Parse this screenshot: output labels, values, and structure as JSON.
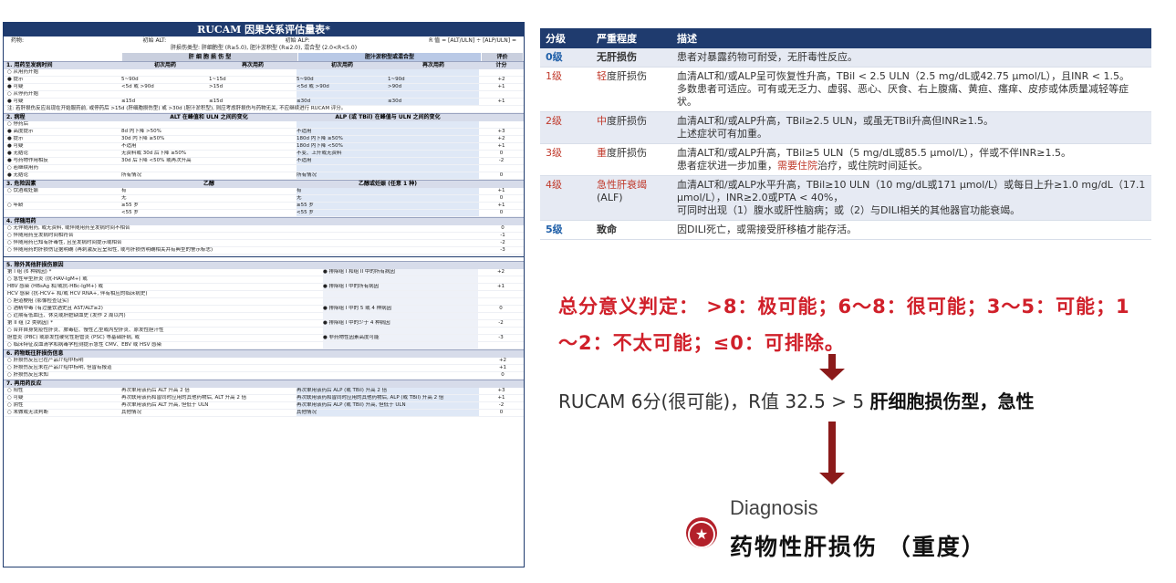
{
  "rucam": {
    "title": "RUCAM 因果关系评估量表*",
    "meta_line1": [
      "药物:",
      "初始 ALT:",
      "初始 ALP:",
      "R 值 = [ALT/ULN] ÷ [ALP/ULN] ="
    ],
    "meta_line2": "肝损伤类型: 肝细胞型 (R≥5.0), 胆汁淤积型 (R≤2.0), 混合型 (2.0<R<5.0)",
    "col_left": "肝 细 胞 损 伤 型",
    "col_right": "胆汁淤积型或混合型",
    "col_score": "评价",
    "sec1": {
      "name": "1. 用药至发病时间",
      "a1": "初次用药",
      "a2": "再次用药",
      "b1": "初次用药",
      "b2": "再次用药",
      "c": "计分"
    },
    "sec1_rows": [
      {
        "c0": "○ 从用药开始",
        "c1": "",
        "c2": "",
        "c3": "",
        "c4": "",
        "c5": ""
      },
      {
        "c0": "● 提示",
        "c1": "5~90d",
        "c2": "1~15d",
        "c3": "5~90d",
        "c4": "1~90d",
        "c5": "+2"
      },
      {
        "c0": "● 可疑",
        "c1": "<5d 或 >90d",
        "c2": ">15d",
        "c3": "<5d 或 >90d",
        "c4": ">90d",
        "c5": "+1"
      },
      {
        "c0": "○ 从停药开始",
        "c1": "",
        "c2": "",
        "c3": "",
        "c4": "",
        "c5": ""
      },
      {
        "c0": "● 可疑",
        "c1": "≤15d",
        "c2": "≤15d",
        "c3": "≤30d",
        "c4": "≤30d",
        "c5": "+1"
      }
    ],
    "sec1_note": "注: 若肝损伤反应出现在开始服药前, 或停药后 >15d (肝细胞损伤型) 或 >30d (胆汁淤积型), 则应考虑肝损伤与药物无关, 不应继续进行 RUCAM 评分。",
    "sec2": {
      "name": "2. 病程",
      "a": "ALT 在峰值和 ULN 之间的变化",
      "b": "ALP (或 TBil) 在峰值与 ULN 之间的变化"
    },
    "sec2_rows": [
      {
        "c0": "○ 停药后",
        "a": "",
        "b": "",
        "s": ""
      },
      {
        "c0": "● 高度提示",
        "a": "8d 内下降 >50%",
        "b": "不适用",
        "s": "+3"
      },
      {
        "c0": "● 提示",
        "a": "30d 内下降 ≥50%",
        "b": "180d 内下降 ≥50%",
        "s": "+2"
      },
      {
        "c0": "● 可疑",
        "a": "不适用",
        "b": "180d 内下降 <50%",
        "s": "+1"
      },
      {
        "c0": "● 无结论",
        "a": "无资料或 30d 后下降 ≥50%",
        "b": "不变、上升或无资料",
        "s": "0"
      },
      {
        "c0": "● 与药物作用相反",
        "a": "30d 后下降 <50% 或再次升高",
        "b": "不适用",
        "s": "-2"
      },
      {
        "c0": "○ 若继续用药",
        "a": "",
        "b": "",
        "s": ""
      },
      {
        "c0": "● 无结论",
        "a": "所有情况",
        "b": "所有情况",
        "s": "0"
      }
    ],
    "sec3": {
      "name": "3. 危险因素",
      "a": "乙醇",
      "b": "乙醇或妊娠 (任意 1 种)"
    },
    "sec3_rows": [
      {
        "c0": "○ 饮酒或妊娠",
        "a": "有",
        "b": "有",
        "s": "+1"
      },
      {
        "c0": "",
        "a": "无",
        "b": "无",
        "s": "0"
      },
      {
        "c0": "○ 年龄",
        "a": "≥55 岁",
        "b": "≥55 岁",
        "s": "+1"
      },
      {
        "c0": "",
        "a": "<55 岁",
        "b": "<55 岁",
        "s": "0"
      }
    ],
    "sec4": {
      "name": "4. 伴随用药"
    },
    "sec4_rows": [
      {
        "t": "○ 无伴随用药, 或无资料, 或伴随用药至发病时间不相合",
        "s": "0"
      },
      {
        "t": "○ 伴随用药至发病时间相符合",
        "s": "-1"
      },
      {
        "t": "○ 伴随用药已知有肝毒性, 且至发病时间提示或相合",
        "s": "-2"
      },
      {
        "t": "○ 伴随用药的肝损伤证据明确 (再刺激反应呈阳性, 或与肝损伤明确相关并有典型的警示标志)",
        "s": "-3"
      }
    ],
    "sec5": {
      "name": "5. 除外其他肝损伤原因"
    },
    "sec5_rows": [
      {
        "l": "第 I 组 (6 种病因) *",
        "m": "● 排除组 I 和组 II 中的所有病因",
        "s": "+2"
      },
      {
        "l": "○ 急性甲型肝炎 (抗-HAV-IgM+) 或",
        "m": "",
        "s": ""
      },
      {
        "l": "HBV 感染 (HBsAg 和/或抗-HBc-IgM+) 或",
        "m": "● 排除组 I 中的所有病因",
        "s": "+1"
      },
      {
        "l": "HCV 感染 (抗-HCV+ 和/或 HCV RNA+, 伴有相应的临床病史)",
        "m": "",
        "s": ""
      },
      {
        "l": "○ 胆道梗阻 (影像检查证实)",
        "m": "",
        "s": ""
      },
      {
        "l": "○ 酒精中毒 (有过量饮酒史且 AST/ALT≥2)",
        "m": "● 排除组 I 中的 5 或 4 种病因",
        "s": "0"
      },
      {
        "l": "○ 近期有低血压、休克或肝脏缺血史 (发作 2 周以内)",
        "m": "",
        "s": ""
      },
      {
        "l": "第 II 组 (2 类病因) *",
        "m": "● 排除组 I 中的少于 4 种病因",
        "s": "-2"
      },
      {
        "l": "○ 合并自身免疫性肝炎、脓毒症、慢性乙型或丙型肝炎、原发性胆汁性",
        "m": "",
        "s": ""
      },
      {
        "l": "胆管炎 (PBC) 或原发性硬化性胆管炎 (PSC) 等基础肝病, 或",
        "m": "● 非药物性因素高度可能",
        "s": "-3"
      },
      {
        "l": "○ 临床特征及血清学和病毒学检测提示急性 CMV、EBV 或 HSV 感染",
        "m": "",
        "s": ""
      }
    ],
    "sec6": {
      "name": "6. 药物既往肝损伤信息"
    },
    "sec6_rows": [
      {
        "t": "○ 肝损伤反应已在产品介绍中标明",
        "s": "+2"
      },
      {
        "t": "○ 肝损伤反应未在产品介绍中标明, 但曾有报道",
        "s": "+1"
      },
      {
        "t": "○ 肝损伤反应未知",
        "s": "0"
      }
    ],
    "sec7": {
      "name": "7. 再用药反应"
    },
    "sec7_rows": [
      {
        "c0": "○ 阳性",
        "a": "再次单用该药后 ALT 升高 2 倍",
        "b": "再次单用该药后 ALP (或 TBil) 升高 2 倍",
        "s": "+3"
      },
      {
        "c0": "○ 可疑",
        "a": "再次联用该药和曾同时应用的其他药物后, ALT 升高 2 倍",
        "b": "再次联用该药和曾同时应用的其他药物后, ALP (或 TBil) 升高 2 倍",
        "s": "+1"
      },
      {
        "c0": "○ 阴性",
        "a": "再次单用该药后 ALT 升高, 但低于 ULN",
        "b": "再次单用该药后 ALP (或 TBil) 升高, 但低于 ULN",
        "s": "-2"
      },
      {
        "c0": "○ 未做或无法判断",
        "a": "其他情况",
        "b": "其他情况",
        "s": "0"
      }
    ]
  },
  "grade_table": {
    "headers": [
      "分级",
      "严重程度",
      "描述"
    ],
    "rows": [
      {
        "level": "0级",
        "severity": "无肝损伤",
        "desc": [
          "患者对暴露药物可耐受，无肝毒性反应。"
        ]
      },
      {
        "level": "1级",
        "severity_prefix": "轻",
        "severity": "度肝损伤",
        "desc": [
          "血清ALT和/或ALP呈可恢复性升高，TBil < 2.5 ULN（2.5 mg/dL或42.75 μmol/L），且INR < 1.5。",
          "多数患者可适应。可有或无乏力、虚弱、恶心、厌食、右上腹痛、黄疸、瘙痒、皮疹或体质量减轻等症状。"
        ]
      },
      {
        "level": "2级",
        "severity_prefix": "中",
        "severity": "度肝损伤",
        "desc": [
          "血清ALT和/或ALP升高，TBil≥2.5 ULN，或虽无TBil升高但INR≥1.5。",
          "上述症状可有加重。"
        ]
      },
      {
        "level": "3级",
        "severity_prefix": "重",
        "severity": "度肝损伤",
        "desc": [
          "血清ALT和/或ALP升高，TBil≥5 ULN（5 mg/dL或85.5 μmol/L），伴或不伴INR≥1.5。",
          "患者症状进一步加重，",
          "需要住院",
          "治疗，或住院时间延长。"
        ]
      },
      {
        "level": "4级",
        "severity_prefix": "急性肝衰竭",
        "severity": "(ALF)",
        "desc": [
          "血清ALT和/或ALP水平升高，TBil≥10 ULN（10 mg/dL或171 μmol/L）或每日上升≥1.0 mg/dL（17.1 μmol/L），INR≥2.0或PTA < 40%，",
          "可同时出现（1）腹水或肝性脑病；或（2）与DILI相关的其他器官功能衰竭。"
        ]
      },
      {
        "level": "5级",
        "severity": "致命",
        "desc": [
          "因DILI死亡，或需接受肝移植才能存活。"
        ]
      }
    ]
  },
  "score_text": "总分意义判定： >8：极可能；6～8：很可能；3～5：可能；1～2：不太可能；≤0：可排除。",
  "rucam_result_prefix": "RUCAM 6分(很可能)，R值 32.5 > 5 ",
  "rucam_result_bold": "肝细胞损伤型，急性",
  "diagnosis_label": "Diagnosis",
  "diagnosis_value": "药物性肝损伤 （重度）",
  "colors": {
    "navy": "#1f3b6e",
    "red": "#d0202a",
    "arrow": "#8b1a1a",
    "blue": "#1f5fa8"
  },
  "icons": {
    "arrows": "down-arrow-icon",
    "diagnosis": "star-badge-icon"
  }
}
